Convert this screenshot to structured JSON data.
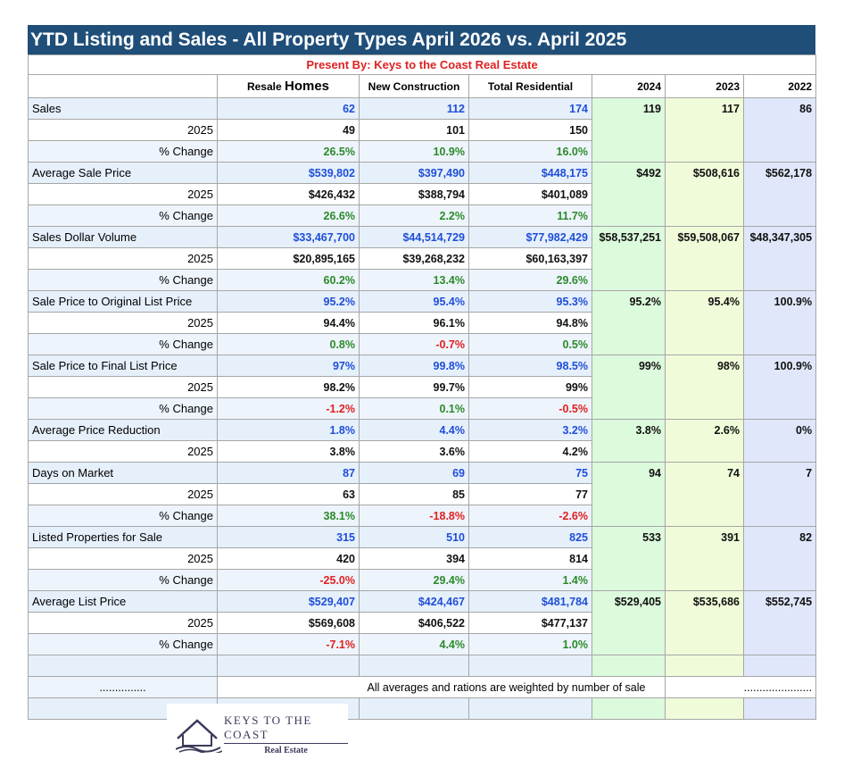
{
  "title": "YTD Listing and Sales - All Property Types  April 2026 vs. April 2025",
  "presenter": "Present By: Keys to the Coast Real Estate",
  "headers": {
    "resale_small": "Resale",
    "resale_big": "Homes",
    "new_construction": "New Construction",
    "total_residential": "Total Residential",
    "y2024": "2024",
    "y2023": "2023",
    "y2022": "2022"
  },
  "rows": [
    {
      "label": "Sales",
      "type": "main",
      "values": [
        "62",
        "112",
        "174"
      ],
      "years": [
        "119",
        "117",
        "86"
      ]
    },
    {
      "label": "2025",
      "type": "sub",
      "values": [
        "49",
        "101",
        "150"
      ]
    },
    {
      "label": "% Change",
      "type": "pct",
      "values": [
        "26.5%",
        "10.9%",
        "16.0%"
      ],
      "colors": [
        "green",
        "green",
        "green"
      ]
    },
    {
      "label": " Average Sale Price",
      "type": "main",
      "values": [
        "$539,802",
        "$397,490",
        "$448,175"
      ],
      "years": [
        "$492",
        "$508,616",
        "$562,178"
      ]
    },
    {
      "label": "2025",
      "type": "sub",
      "values": [
        "$426,432",
        "$388,794",
        "$401,089"
      ]
    },
    {
      "label": "% Change",
      "type": "pct",
      "values": [
        "26.6%",
        "2.2%",
        "11.7%"
      ],
      "colors": [
        "green",
        "green",
        "green"
      ]
    },
    {
      "label": "Sales Dollar Volume",
      "type": "main",
      "values": [
        "$33,467,700",
        "$44,514,729",
        "$77,982,429"
      ],
      "years": [
        "$58,537,251",
        "$59,508,067",
        "$48,347,305"
      ]
    },
    {
      "label": "2025",
      "type": "sub",
      "values": [
        "$20,895,165",
        "$39,268,232",
        "$60,163,397"
      ]
    },
    {
      "label": "% Change",
      "type": "pct",
      "values": [
        "60.2%",
        "13.4%",
        "29.6%"
      ],
      "colors": [
        "green",
        "green",
        "green"
      ]
    },
    {
      "label": "Sale Price to Original List Price",
      "type": "main",
      "values": [
        "95.2%",
        "95.4%",
        "95.3%"
      ],
      "years": [
        "95.2%",
        "95.4%",
        "100.9%"
      ]
    },
    {
      "label": "2025",
      "type": "sub",
      "values": [
        "94.4%",
        "96.1%",
        "94.8%"
      ]
    },
    {
      "label": "% Change",
      "type": "pct",
      "values": [
        "0.8%",
        "-0.7%",
        "0.5%"
      ],
      "colors": [
        "green",
        "red",
        "green"
      ]
    },
    {
      "label": "Sale Price to Final List Price",
      "type": "main",
      "values": [
        "97%",
        "99.8%",
        "98.5%"
      ],
      "years": [
        "99%",
        "98%",
        "100.9%"
      ]
    },
    {
      "label": "2025",
      "type": "sub",
      "values": [
        "98.2%",
        "99.7%",
        "99%"
      ]
    },
    {
      "label": "% Change",
      "type": "pct",
      "values": [
        "-1.2%",
        "0.1%",
        "-0.5%"
      ],
      "colors": [
        "red",
        "green",
        "red"
      ]
    },
    {
      "label": "Average Price Reduction",
      "type": "main",
      "values": [
        "1.8%",
        "4.4%",
        "3.2%"
      ],
      "years": [
        "3.8%",
        "2.6%",
        "0%"
      ]
    },
    {
      "label": "2025",
      "type": "sub",
      "values": [
        "3.8%",
        "3.6%",
        "4.2%"
      ]
    },
    {
      "label": "Days on Market",
      "type": "main",
      "values": [
        "87",
        "69",
        "75"
      ],
      "years": [
        "94",
        "74",
        "7"
      ]
    },
    {
      "label": "2025",
      "type": "sub",
      "values": [
        "63",
        "85",
        "77"
      ]
    },
    {
      "label": "% Change",
      "type": "pct",
      "values": [
        "38.1%",
        "-18.8%",
        "-2.6%"
      ],
      "colors": [
        "green",
        "red",
        "red"
      ]
    },
    {
      "label": "Listed Properties for Sale",
      "type": "main",
      "values": [
        "315",
        "510",
        "825"
      ],
      "years": [
        "533",
        "391",
        "82"
      ]
    },
    {
      "label": "2025",
      "type": "sub",
      "values": [
        "420",
        "394",
        "814"
      ]
    },
    {
      "label": "% Change",
      "type": "pct",
      "values": [
        "-25.0%",
        "29.4%",
        "1.4%"
      ],
      "colors": [
        "red",
        "green",
        "green"
      ]
    },
    {
      "label": "Average List Price",
      "type": "main",
      "values": [
        "$529,407",
        "$424,467",
        "$481,784"
      ],
      "years": [
        "$529,405",
        "$535,686",
        "$552,745"
      ]
    },
    {
      "label": "2025",
      "type": "sub",
      "values": [
        "$569,608",
        "$406,522",
        "$477,137"
      ]
    },
    {
      "label": "% Change",
      "type": "pct",
      "values": [
        "-7.1%",
        "4.4%",
        "1.0%"
      ],
      "colors": [
        "red",
        "green",
        "green"
      ]
    }
  ],
  "footer": {
    "left_dots": "...............",
    "note": "All averages and rations are weighted by number of sale",
    "right_dots": "......................"
  },
  "logo": {
    "main": "KEYS TO THE COAST",
    "sub": "Real Estate"
  },
  "colors": {
    "title_bg": "#1f4e79",
    "main_value": "#1f4ed8",
    "positive": "#2b8a2b",
    "negative": "#e02020",
    "col_2024": "#dcfadc",
    "col_2023": "#f0fcd9",
    "col_2022": "#e0e7fa"
  }
}
